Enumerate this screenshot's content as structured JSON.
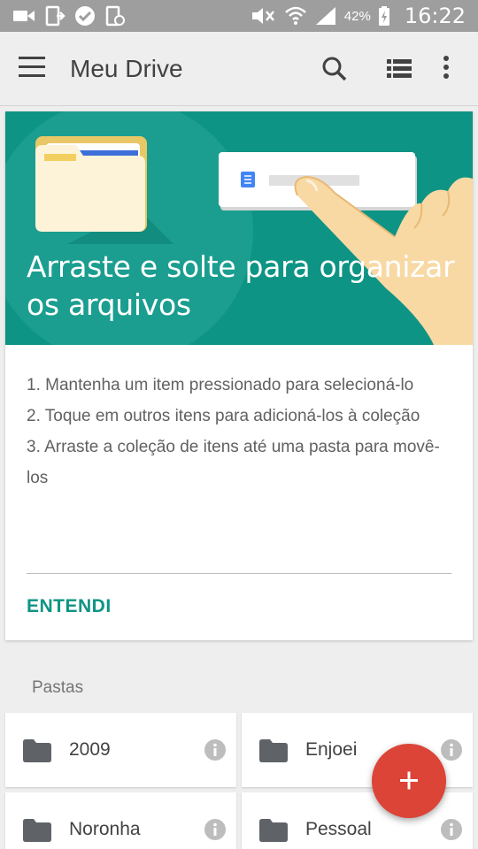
{
  "status_bar": {
    "battery": "42%",
    "time": "16:22",
    "icons": [
      "video-icon",
      "screen-icon",
      "check-icon",
      "screenshot-icon",
      "mute-icon",
      "wifi-icon",
      "signal-icon",
      "battery-charging-icon"
    ]
  },
  "app_bar": {
    "title": "Meu Drive",
    "icons": [
      "menu-icon",
      "search-icon",
      "list-view-icon",
      "more-vert-icon"
    ]
  },
  "tutorial_card": {
    "hero_title": "Arraste e solte para organizar os arquivos",
    "steps": [
      "1. Mantenha um item pressionado para selecioná-lo",
      "2. Toque em outros itens para adicioná-los à coleção",
      "3. Arraste a coleção de itens até uma pasta para movê-los"
    ],
    "dismiss_label": "ENTENDI"
  },
  "folders": {
    "section_label": "Pastas",
    "items": [
      {
        "name": "2009"
      },
      {
        "name": "Enjoei"
      },
      {
        "name": "Noronha"
      },
      {
        "name": "Pessoal"
      }
    ]
  },
  "fab": {
    "icon": "plus-icon"
  },
  "colors": {
    "accent": "#0e9484",
    "fab": "#db4437",
    "status_bar": "#9e9e9e",
    "app_bar": "#eeeeee"
  }
}
